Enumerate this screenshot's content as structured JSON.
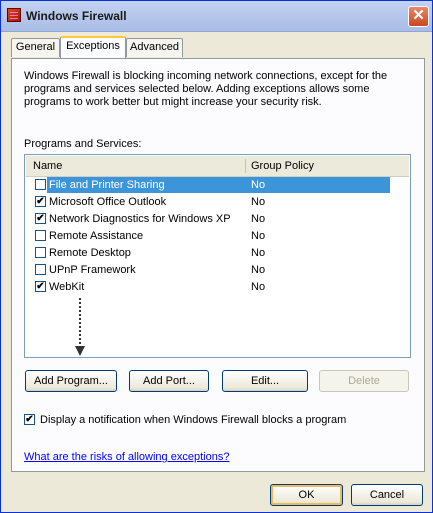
{
  "window": {
    "title": "Windows Firewall",
    "close_glyph": "✕"
  },
  "tabs": [
    {
      "label": "General"
    },
    {
      "label": "Exceptions"
    },
    {
      "label": "Advanced"
    }
  ],
  "description": "Windows Firewall is blocking incoming network connections, except for the programs and services selected below. Adding exceptions allows some programs to work better but might increase your security risk.",
  "list": {
    "label": "Programs and Services:",
    "columns": {
      "name": "Name",
      "group_policy": "Group Policy"
    },
    "rows": [
      {
        "name": "File and Printer Sharing",
        "group_policy": "No",
        "checked": false,
        "selected": true
      },
      {
        "name": "Microsoft Office Outlook",
        "group_policy": "No",
        "checked": true,
        "selected": false
      },
      {
        "name": "Network Diagnostics for Windows XP",
        "group_policy": "No",
        "checked": true,
        "selected": false
      },
      {
        "name": "Remote Assistance",
        "group_policy": "No",
        "checked": false,
        "selected": false
      },
      {
        "name": "Remote Desktop",
        "group_policy": "No",
        "checked": false,
        "selected": false
      },
      {
        "name": "UPnP Framework",
        "group_policy": "No",
        "checked": false,
        "selected": false
      },
      {
        "name": "WebKit",
        "group_policy": "No",
        "checked": true,
        "selected": false
      }
    ]
  },
  "buttons": {
    "add_program": "Add Program...",
    "add_port": "Add Port...",
    "edit": "Edit...",
    "delete": "Delete",
    "ok": "OK",
    "cancel": "Cancel"
  },
  "notify": {
    "label": "Display a notification when Windows Firewall blocks a program",
    "checked": true
  },
  "risk_link": "What are the risks of allowing exceptions?",
  "colors": {
    "selection": "#3d95d9",
    "link": "#0000ff",
    "dialog_bg": "#ece9d8"
  },
  "check_glyph": "✔"
}
